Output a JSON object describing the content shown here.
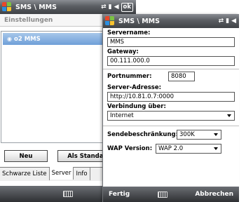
{
  "back": {
    "title": "SMS \\ MMS",
    "ok_label": "ok",
    "heading": "Einstellungen",
    "list_items": [
      {
        "label": "o2 MMS"
      }
    ],
    "buttons": {
      "new": "Neu",
      "as_default": "Als Standard"
    },
    "tabs": [
      "Schwarze Liste",
      "Server",
      "Info"
    ]
  },
  "front": {
    "title": "SMS \\ MMS",
    "server_name_label": "Servername:",
    "server_name_value": "MMS",
    "gateway_label": "Gateway:",
    "gateway_value": "00.111.000.0",
    "port_label": "Portnummer:",
    "port_value": "8080",
    "server_address_label": "Server-Adresse:",
    "server_address_value": "http://10.81.0.7:0000",
    "connection_label": "Verbindung über:",
    "connection_value": "Internet",
    "send_limit_label": "Sendebeschränkung:",
    "send_limit_value": "300K",
    "wap_label": "WAP Version:",
    "wap_value": "WAP 2.0",
    "softkey_left": "Fertig",
    "softkey_right": "Abbrechen"
  },
  "colors": {
    "titlebar": "#4a4d52",
    "selection": "#7ea8dc"
  }
}
